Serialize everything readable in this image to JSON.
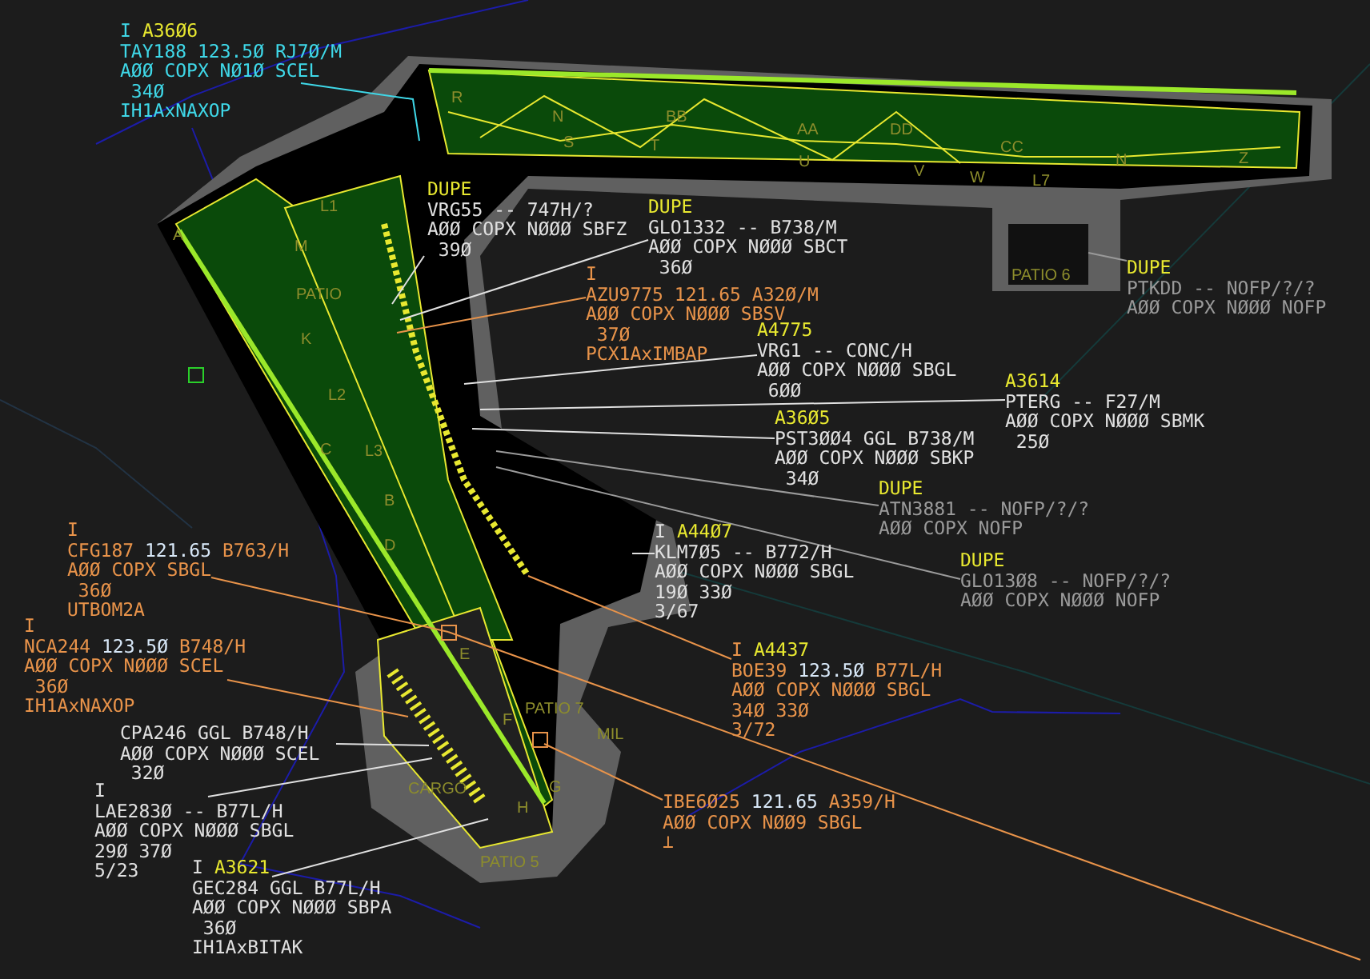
{
  "tags": [
    {
      "color": "#3fd8e8",
      "status": "I",
      "code": "A36Ø6",
      "callsign": "TAY188",
      "frequency": "123.5Ø",
      "frequency_lit": false,
      "type": "RJ7Ø/M",
      "lines": [
        "AØØ COPX NØ1Ø SCEL",
        " 34Ø",
        "IH1AxNAXOP"
      ]
    },
    {
      "color": "#e0e0e0",
      "code": "DUPE",
      "callsign": "VRG55",
      "frequency": "--",
      "frequency_lit": false,
      "type": "747H/?",
      "lines": [
        "AØØ COPX NØØØ SBFZ",
        " 39Ø"
      ]
    },
    {
      "color": "#e0e0e0",
      "code": "DUPE",
      "callsign": "GLO1332",
      "frequency": "--",
      "frequency_lit": false,
      "type": "B738/M",
      "lines": [
        "AØØ COPX NØØØ SBCT",
        " 36Ø"
      ]
    },
    {
      "color": "#e8934a",
      "status": "I",
      "callsign": "AZU9775",
      "frequency": "121.65",
      "frequency_lit": false,
      "type": "A32Ø/M",
      "lines": [
        "AØØ COPX NØØØ SBSV",
        " 37Ø",
        "PCX1AxIMBAP"
      ]
    },
    {
      "color": "#9a9a9a",
      "code": "DUPE",
      "callsign": "PTKDD",
      "frequency": "--",
      "frequency_lit": false,
      "type": "NOFP/?/?",
      "lines": [
        "AØØ COPX NØØØ NOFP"
      ]
    },
    {
      "color": "#e0e0e0",
      "code": "A4775",
      "callsign": "VRG1",
      "frequency": "--",
      "frequency_lit": false,
      "type": "CONC/H",
      "lines": [
        "AØØ COPX NØØØ SBGL",
        " 6ØØ"
      ]
    },
    {
      "color": "#e0e0e0",
      "code": "A3614",
      "callsign": "PTERG",
      "frequency": "--",
      "frequency_lit": false,
      "type": "F27/M",
      "lines": [
        "AØØ COPX NØØØ SBMK",
        " 25Ø"
      ]
    },
    {
      "color": "#e0e0e0",
      "code": "A36Ø5",
      "callsign": "PST3ØØ4",
      "frequency": "GGL",
      "frequency_lit": false,
      "type": "B738/M",
      "lines": [
        "AØØ COPX NØØØ SBKP",
        " 34Ø"
      ]
    },
    {
      "color": "#9a9a9a",
      "code": "DUPE",
      "callsign": "ATN3881",
      "frequency": "--",
      "frequency_lit": false,
      "type": "NOFP/?/?",
      "lines": [
        "AØØ COPX NOFP"
      ]
    },
    {
      "color": "#e8934a",
      "status": "I",
      "callsign": "CFG187",
      "frequency": "121.65",
      "frequency_lit": true,
      "type": "B763/H",
      "lines": [
        "AØØ COPX SBGL",
        " 36Ø",
        "UTBOM2A"
      ]
    },
    {
      "color": "#e0e0e0",
      "status": "I",
      "code": "A44Ø7",
      "callsign": "KLM7Ø5",
      "frequency": "--",
      "frequency_lit": false,
      "type": "B772/H",
      "lines": [
        "AØØ COPX NØØØ SBGL",
        "19Ø 33Ø",
        "3/67"
      ]
    },
    {
      "color": "#9a9a9a",
      "code": "DUPE",
      "callsign": "GLO13Ø8",
      "frequency": "--",
      "frequency_lit": false,
      "type": "NOFP/?/?",
      "lines": [
        "AØØ COPX NØØØ NOFP"
      ]
    },
    {
      "color": "#e8934a",
      "status": "I",
      "callsign": "NCA244",
      "frequency": "123.5Ø",
      "frequency_lit": true,
      "type": "B748/H",
      "lines": [
        "AØØ COPX NØØØ SCEL",
        " 36Ø",
        "IH1AxNAXOP"
      ]
    },
    {
      "color": "#e8934a",
      "status": "I",
      "code": "A4437",
      "callsign": "BOE39",
      "frequency": "123.5Ø",
      "frequency_lit": true,
      "type": "B77L/H",
      "lines": [
        "AØØ COPX NØØØ SBGL",
        "34Ø 33Ø",
        "3/72"
      ]
    },
    {
      "color": "#e0e0e0",
      "callsign": "CPA246",
      "frequency": "GGL",
      "frequency_lit": false,
      "type": "B748/H",
      "lines": [
        "AØØ COPX NØØØ SCEL",
        " 32Ø"
      ]
    },
    {
      "color": "#e0e0e0",
      "status": "I",
      "callsign": "LAE283Ø",
      "frequency": "--",
      "frequency_lit": false,
      "type": "B77L/H",
      "lines": [
        "AØØ COPX NØØØ SBGL",
        "29Ø 37Ø",
        "5/23"
      ]
    },
    {
      "color": "#e8934a",
      "callsign": "IBE6Ø25",
      "frequency": "121.65",
      "frequency_lit": true,
      "type": "A359/H",
      "lines": [
        "AØØ COPX NØØ9 SBGL",
        "⊥"
      ]
    },
    {
      "color": "#e0e0e0",
      "status": "I",
      "code": "A3621",
      "callsign": "GEC284",
      "frequency": "GGL",
      "frequency_lit": false,
      "type": "B77L/H",
      "lines": [
        "AØØ COPX NØØØ SBPA",
        " 36Ø",
        "IH1AxBITAK"
      ]
    }
  ],
  "map_labels": [
    {
      "text": "R"
    },
    {
      "text": "N"
    },
    {
      "text": "BB"
    },
    {
      "text": "AA"
    },
    {
      "text": "DD"
    },
    {
      "text": "CC"
    },
    {
      "text": "N"
    },
    {
      "text": "Z"
    },
    {
      "text": "S"
    },
    {
      "text": "T"
    },
    {
      "text": "U"
    },
    {
      "text": "V"
    },
    {
      "text": "W"
    },
    {
      "text": "L7"
    },
    {
      "text": "M"
    },
    {
      "text": "L1"
    },
    {
      "text": "PATIO"
    },
    {
      "text": "K"
    },
    {
      "text": "L2"
    },
    {
      "text": "C"
    },
    {
      "text": "L3"
    },
    {
      "text": "B"
    },
    {
      "text": "A"
    },
    {
      "text": "D"
    },
    {
      "text": "E"
    },
    {
      "text": "F"
    },
    {
      "text": "G"
    },
    {
      "text": "H"
    },
    {
      "text": "PATIO 5"
    },
    {
      "text": "PATIO 6"
    },
    {
      "text": "PATIO 7"
    },
    {
      "text": "MIL"
    },
    {
      "text": "CARGO"
    }
  ]
}
